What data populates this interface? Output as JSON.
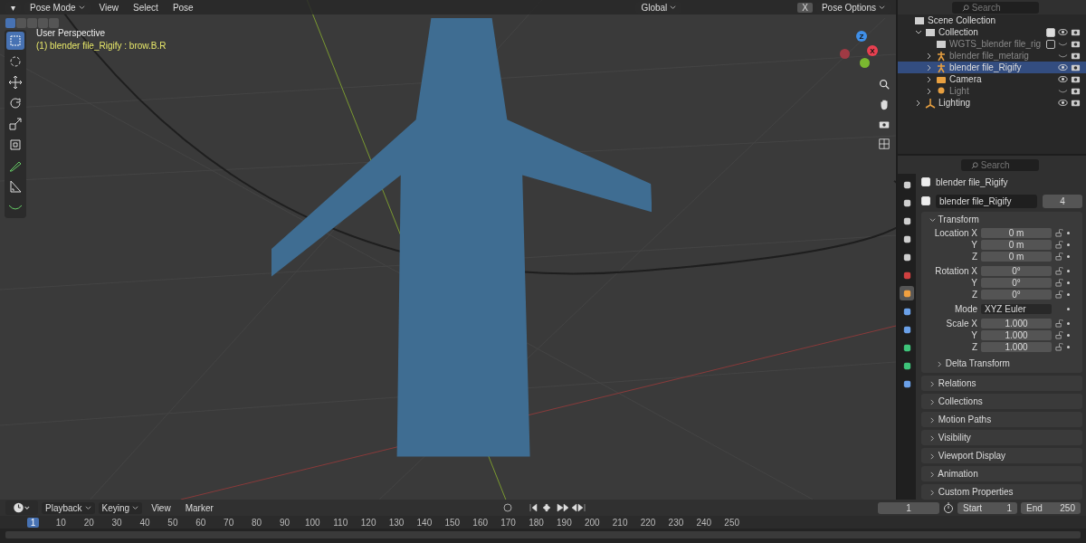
{
  "header": {
    "editor_menu": "▾",
    "mode": "Pose Mode",
    "menus": [
      "View",
      "Select",
      "Pose"
    ],
    "orientation": "Global",
    "pose_options": "Pose Options",
    "x_toggle": "X"
  },
  "select_modes": [
    {
      "selected": true
    },
    {
      "selected": false
    },
    {
      "selected": false
    },
    {
      "selected": false
    },
    {
      "selected": false
    }
  ],
  "viewport": {
    "perspective": "User Perspective",
    "active": "(1) blender file_Rigify : brow.B.R",
    "gizmo": {
      "z": "Z",
      "x": "X"
    }
  },
  "tools": [
    {
      "kind": "select",
      "selected": true
    },
    {
      "kind": "cursor",
      "selected": false
    },
    {
      "kind": "move",
      "selected": false
    },
    {
      "kind": "rotate",
      "selected": false
    },
    {
      "kind": "scale",
      "selected": false
    },
    {
      "kind": "transform",
      "selected": false
    },
    {
      "kind": "annotate",
      "selected": false
    },
    {
      "kind": "measure",
      "selected": false
    },
    {
      "kind": "bone",
      "selected": false
    }
  ],
  "outliner": {
    "search": {
      "placeholder": "Search"
    },
    "items": [
      {
        "name": "Scene Collection",
        "kind": "scene",
        "selected": false,
        "dimmed": false,
        "children": [
          {
            "name": "Collection",
            "kind": "collection",
            "selected": false,
            "dimmed": false,
            "expanded": true,
            "checked": true,
            "visible": true,
            "children": [
              {
                "name": "WGTS_blender file_rig",
                "kind": "collection",
                "selected": false,
                "dimmed": true,
                "checked": false,
                "visible": false
              },
              {
                "name": "blender file_metarig",
                "kind": "armature",
                "selected": false,
                "dimmed": true,
                "expanded": false,
                "visible": false
              },
              {
                "name": "blender file_Rigify",
                "kind": "armature",
                "selected": true,
                "dimmed": false,
                "expanded": false,
                "visible": true
              },
              {
                "name": "Camera",
                "kind": "camera",
                "selected": false,
                "dimmed": false,
                "expanded": false,
                "visible": true
              },
              {
                "name": "Light",
                "kind": "light",
                "selected": false,
                "dimmed": true,
                "expanded": false,
                "visible": false
              }
            ]
          },
          {
            "name": "Lighting",
            "kind": "empty",
            "selected": false,
            "dimmed": false,
            "expanded": false,
            "visible": true
          }
        ]
      }
    ]
  },
  "properties": {
    "search": {
      "placeholder": "Search"
    },
    "tabs": [
      {
        "kind": "tool",
        "selected": false
      },
      {
        "kind": "render",
        "selected": false
      },
      {
        "kind": "output",
        "selected": false
      },
      {
        "kind": "view",
        "selected": false
      },
      {
        "kind": "scene",
        "selected": false
      },
      {
        "kind": "world",
        "selected": false
      },
      {
        "kind": "object",
        "selected": true
      },
      {
        "kind": "modifier",
        "selected": false
      },
      {
        "kind": "physics",
        "selected": false
      },
      {
        "kind": "armature",
        "selected": false
      },
      {
        "kind": "bone",
        "selected": false
      },
      {
        "kind": "constraint",
        "selected": false
      }
    ],
    "object_name": "blender file_Rigify",
    "data_name": "blender file_Rigify",
    "users": "4",
    "transform": {
      "title": "Transform",
      "expanded": true,
      "groups": [
        {
          "rows": [
            {
              "label": "Location X",
              "value": "0 m"
            },
            {
              "label": "Y",
              "value": "0 m"
            },
            {
              "label": "Z",
              "value": "0 m"
            }
          ]
        },
        {
          "rows": [
            {
              "label": "Rotation X",
              "value": "0°"
            },
            {
              "label": "Y",
              "value": "0°"
            },
            {
              "label": "Z",
              "value": "0°"
            }
          ]
        },
        {
          "mode_label": "Mode",
          "mode": "XYZ Euler"
        },
        {
          "rows": [
            {
              "label": "Scale X",
              "value": "1.000"
            },
            {
              "label": "Y",
              "value": "1.000"
            },
            {
              "label": "Z",
              "value": "1.000"
            }
          ]
        }
      ],
      "subpanel": "Delta Transform"
    },
    "panels": [
      "Relations",
      "Collections",
      "Motion Paths",
      "Visibility",
      "Viewport Display",
      "Animation",
      "Custom Properties"
    ]
  },
  "timeline": {
    "menus": [
      "Playback",
      "Keying",
      "View",
      "Marker"
    ],
    "current_frame": "1",
    "start_label": "Start",
    "start": "1",
    "end_label": "End",
    "end": "250",
    "ticks": [
      "1",
      "10",
      "20",
      "30",
      "40",
      "50",
      "60",
      "70",
      "80",
      "90",
      "100",
      "110",
      "120",
      "130",
      "140",
      "150",
      "160",
      "170",
      "180",
      "190",
      "200",
      "210",
      "220",
      "230",
      "240",
      "250"
    ]
  }
}
